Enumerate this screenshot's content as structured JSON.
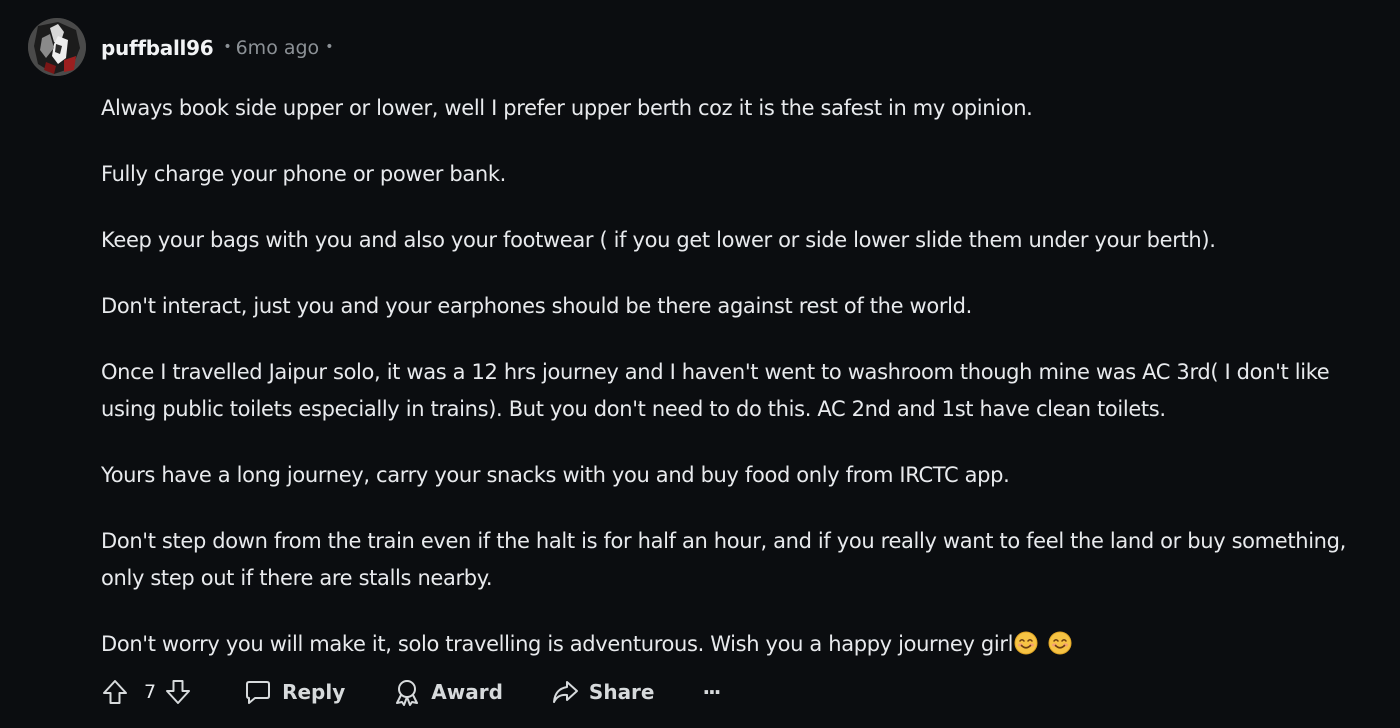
{
  "comment": {
    "author": "puffball96",
    "age": "6mo ago",
    "paragraphs": [
      "Always book side upper or lower, well I prefer upper berth coz it is the safest in my opinion.",
      "Fully charge your phone or power bank.",
      "Keep your bags with you and also your footwear ( if you get lower or side lower slide them under your berth).",
      "Don't interact, just you and your earphones should be there against rest of the world.",
      "Once I travelled Jaipur solo, it was a 12 hrs journey and I haven't went to washroom though mine was AC 3rd( I don't like using public toilets especially in trains). But you don't need to do this. AC 2nd and 1st have clean toilets.",
      "Yours have a long journey, carry your snacks with you and buy food only from IRCTC app.",
      "Don't step down from the train even if the halt is for half an hour, and if you really want to feel the land or buy something, only step out if there are stalls nearby.",
      "Don't worry you will make it, solo travelling is adventurous. Wish you a happy journey girl"
    ],
    "last_paragraph_emojis": [
      "smiling-face-emoji",
      "smiling-face-emoji"
    ]
  },
  "actions": {
    "vote_count": "7",
    "reply_label": "Reply",
    "award_label": "Award",
    "share_label": "Share",
    "more_label": "···"
  },
  "colors": {
    "background": "#0b0d10",
    "text": "#e8eaed",
    "meta": "#8c9196",
    "emoji": "#f6c344"
  }
}
